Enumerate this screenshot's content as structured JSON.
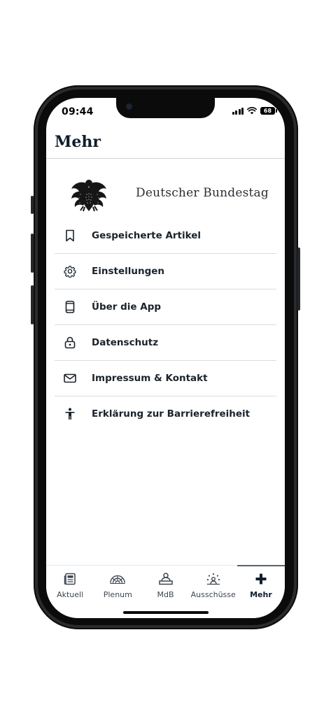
{
  "status": {
    "time": "09:44",
    "battery": "68"
  },
  "header": {
    "title": "Mehr"
  },
  "brand": {
    "name": "Deutscher Bundestag",
    "logo_icon": "federal-eagle-logo"
  },
  "menu": {
    "items": [
      {
        "label": "Gespeicherte Artikel",
        "icon": "bookmark-icon"
      },
      {
        "label": "Einstellungen",
        "icon": "gear-icon"
      },
      {
        "label": "Über die App",
        "icon": "phone-device-icon"
      },
      {
        "label": "Datenschutz",
        "icon": "lock-icon"
      },
      {
        "label": "Impressum & Kontakt",
        "icon": "envelope-icon"
      },
      {
        "label": "Erklärung zur Barrierefreiheit",
        "icon": "accessibility-icon"
      }
    ]
  },
  "tabbar": {
    "active": "Mehr",
    "tabs": [
      {
        "label": "Aktuell",
        "icon": "newspaper-icon"
      },
      {
        "label": "Plenum",
        "icon": "plenary-hall-icon"
      },
      {
        "label": "MdB",
        "icon": "member-lectern-icon"
      },
      {
        "label": "Ausschüsse",
        "icon": "committee-icon"
      },
      {
        "label": "Mehr",
        "icon": "plus-icon"
      }
    ]
  },
  "colors": {
    "accent": "#0f1d2b",
    "divider": "#d9dcdf",
    "text": "#1a232c"
  }
}
